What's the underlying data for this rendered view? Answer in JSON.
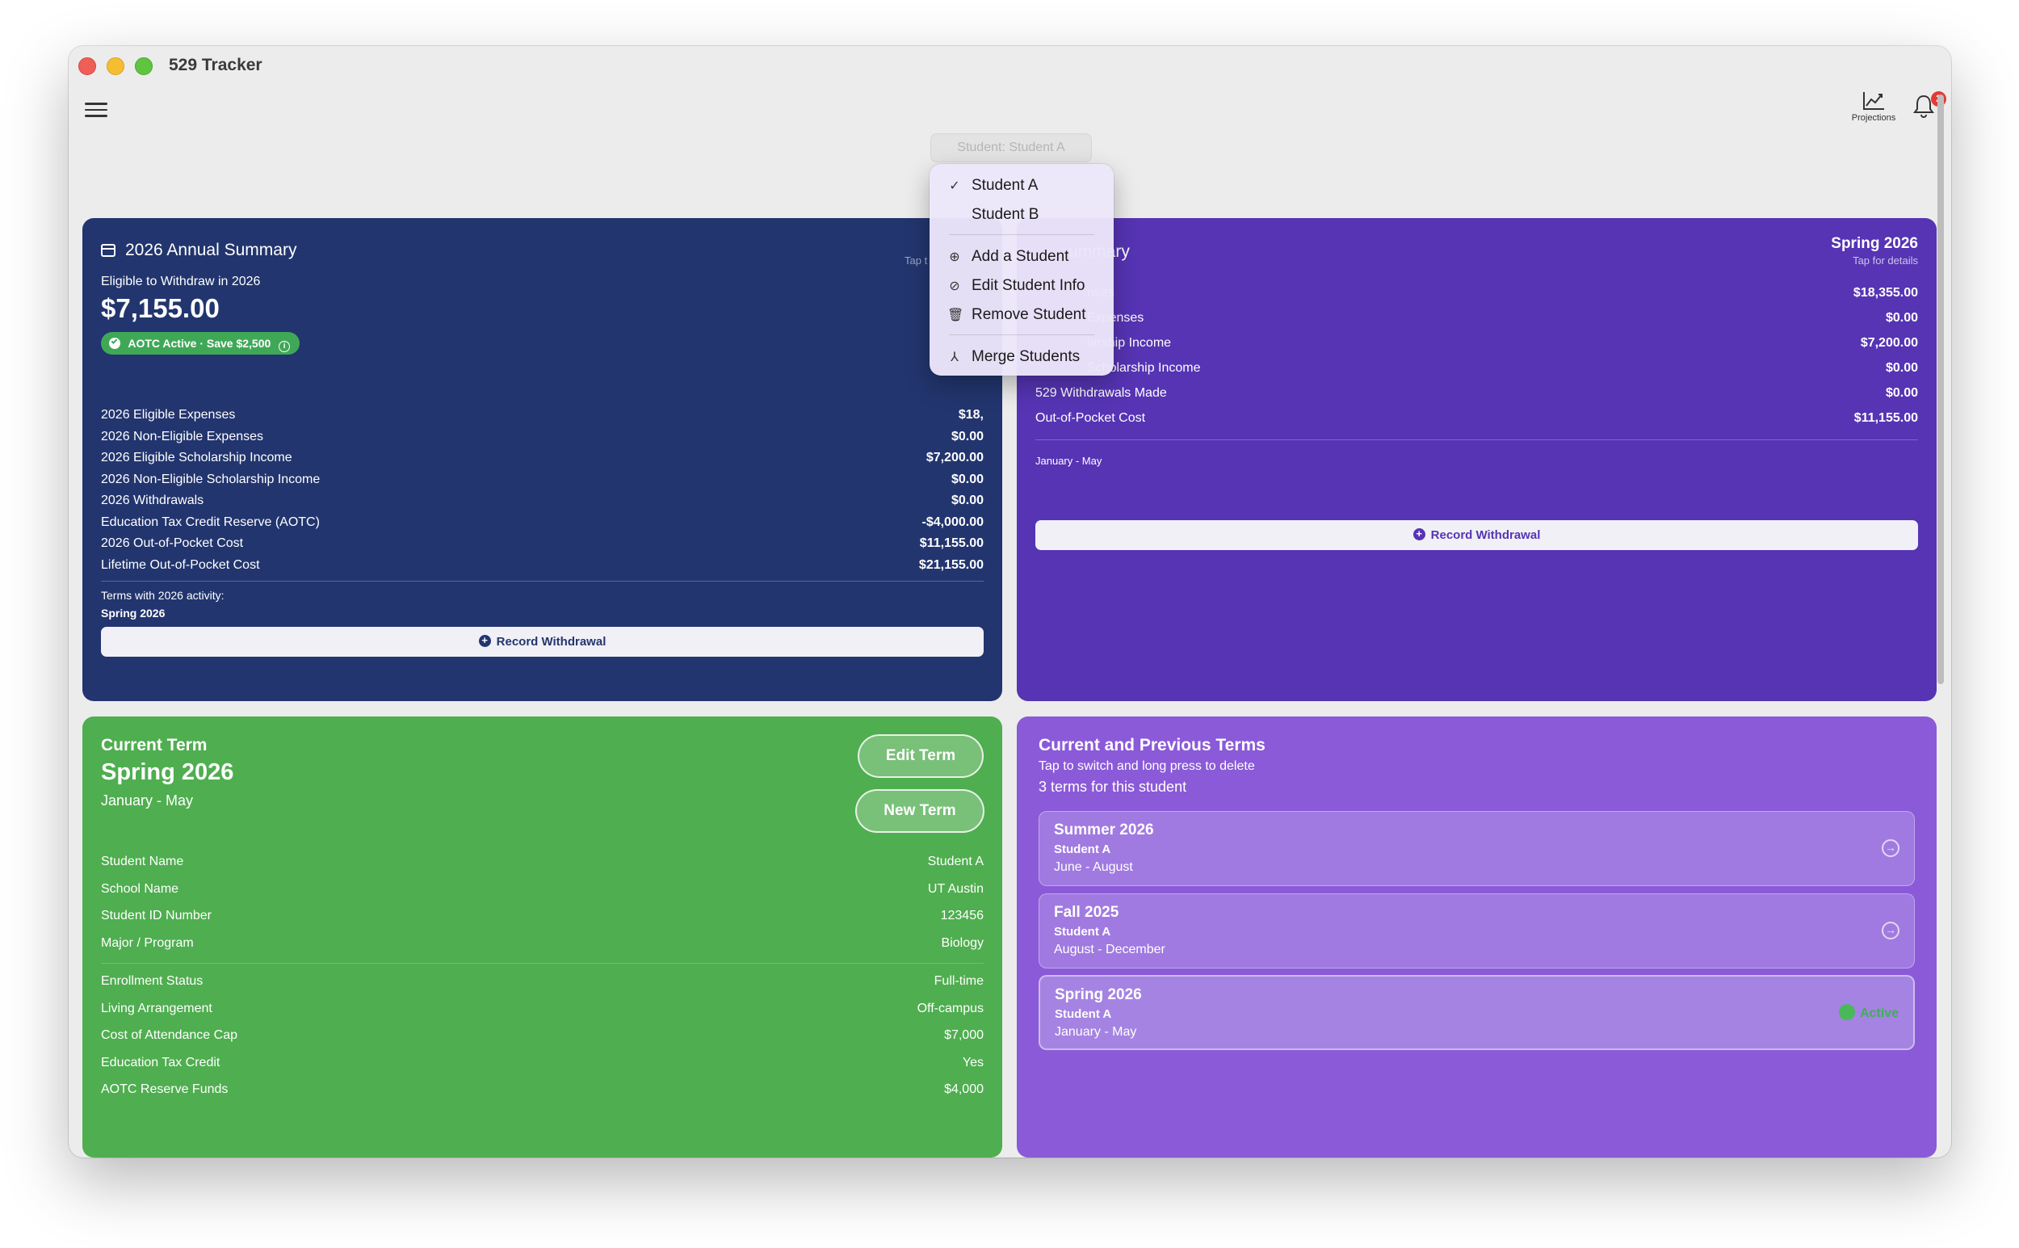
{
  "app": {
    "title": "529 Tracker"
  },
  "toolbar": {
    "projections_label": "Projections",
    "notification_count": "2"
  },
  "student_picker": {
    "label": "Student:  Student A"
  },
  "menu": {
    "items": [
      {
        "label": "Student A",
        "icon": "checkmark-icon",
        "checked": true
      },
      {
        "label": "Student B",
        "icon": ""
      },
      {
        "label": "Add a Student",
        "icon": "plus-circle-icon"
      },
      {
        "label": "Edit Student Info",
        "icon": "pencil-circle-icon"
      },
      {
        "label": "Remove Student",
        "icon": "trash-icon"
      },
      {
        "label": "Merge Students",
        "icon": "merge-icon"
      }
    ]
  },
  "annual": {
    "title": "2026 Annual Summary",
    "tap_hint": "Tap t",
    "eligible_label": "Eligible to Withdraw in 2026",
    "eligible_amount": "$7,155.00",
    "aotc_badge": "AOTC Active · Save $2,500",
    "rows": [
      {
        "label": "2026 Eligible Expenses",
        "value": "$18,"
      },
      {
        "label": "2026 Non-Eligible Expenses",
        "value": "$0.00"
      },
      {
        "label": "2026 Eligible Scholarship Income",
        "value": "$7,200.00"
      },
      {
        "label": "2026 Non-Eligible Scholarship Income",
        "value": "$0.00"
      },
      {
        "label": "2026 Withdrawals",
        "value": "$0.00"
      },
      {
        "label": "Education Tax Credit Reserve (AOTC)",
        "value": "-$4,000.00"
      },
      {
        "label": "2026 Out-of-Pocket Cost",
        "value": "$11,155.00"
      },
      {
        "label": "Lifetime Out-of-Pocket Cost",
        "value": "$21,155.00"
      }
    ],
    "terms_label": "Terms with 2026 activity:",
    "terms_value": "Spring 2026",
    "record_withdrawal": "Record Withdrawal"
  },
  "term_summary": {
    "title": "ummary",
    "term": "Spring 2026",
    "tap_hint": "Tap for details",
    "rows": [
      {
        "label": "nses",
        "value": "$18,355.00"
      },
      {
        "label": "Expenses",
        "value": "$0.00"
      },
      {
        "label": "larship Income",
        "value": "$7,200.00"
      },
      {
        "label": "Scholarship Income",
        "value": "$0.00"
      },
      {
        "label": "529 Withdrawals Made",
        "value": "$0.00"
      },
      {
        "label": "Out-of-Pocket Cost",
        "value": "$11,155.00"
      }
    ],
    "date_range": "January - May",
    "record_withdrawal": "Record Withdrawal"
  },
  "current_term": {
    "heading": "Current Term",
    "term_name": "Spring 2026",
    "date_range": "January - May",
    "edit_term": "Edit Term",
    "new_term": "New Term",
    "rows_a": [
      {
        "label": "Student Name",
        "value": "Student A"
      },
      {
        "label": "School Name",
        "value": "UT Austin"
      },
      {
        "label": "Student ID Number",
        "value": "123456"
      },
      {
        "label": "Major / Program",
        "value": "Biology"
      }
    ],
    "rows_b": [
      {
        "label": "Enrollment Status",
        "value": "Full-time"
      },
      {
        "label": "Living Arrangement",
        "value": "Off-campus"
      },
      {
        "label": "Cost of Attendance Cap",
        "value": "$7,000"
      },
      {
        "label": "Education Tax Credit",
        "value": "Yes"
      },
      {
        "label": "AOTC Reserve Funds",
        "value": "$4,000"
      }
    ]
  },
  "terms_list": {
    "heading": "Current and Previous Terms",
    "hint": "Tap to switch and long press to delete",
    "count": "3 terms for this student",
    "items": [
      {
        "name": "Summer 2026",
        "student": "Student A",
        "dates": "June - August"
      },
      {
        "name": "Fall 2025",
        "student": "Student A",
        "dates": "August - December"
      },
      {
        "name": "Spring 2026",
        "student": "Student A",
        "dates": "January - May",
        "status": "Active"
      }
    ]
  },
  "colors": {
    "annual_bg": "#22356e",
    "term_summary_bg": "#5634b4",
    "current_term_bg": "#4fae4f",
    "terms_list_bg": "#8b5ad8"
  }
}
